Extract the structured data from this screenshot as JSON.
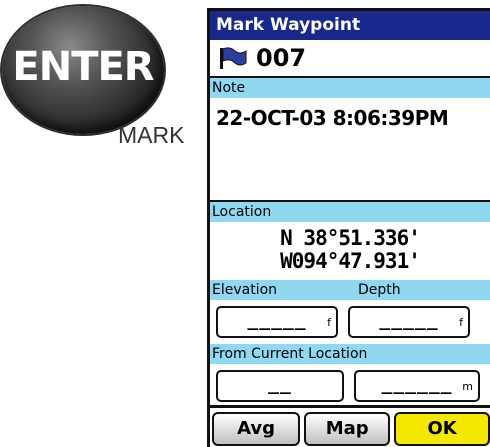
{
  "hardware": {
    "button_label": "ENTER",
    "caption": "MARK"
  },
  "screen": {
    "title": "Mark Waypoint",
    "waypoint_icon": "flag-icon",
    "waypoint_name": "007",
    "note_label": "Note",
    "note_text": "22-OCT-03 8:06:39PM",
    "location_label": "Location",
    "latitude": "N 38°51.336'",
    "longitude": "W094°47.931'",
    "elevation_label": "Elevation",
    "depth_label": "Depth",
    "elevation_value": "_____",
    "elevation_unit": "f",
    "depth_value": "_____",
    "depth_unit": "f",
    "from_current_label": "From Current Location",
    "bearing_value": "__",
    "distance_value": "______",
    "distance_unit": "m",
    "buttons": {
      "avg": "Avg",
      "map": "Map",
      "ok": "OK"
    }
  },
  "colors": {
    "title_bg": "#18288c",
    "label_bg": "#8fd8f0",
    "ok_bg": "#f4e800"
  }
}
